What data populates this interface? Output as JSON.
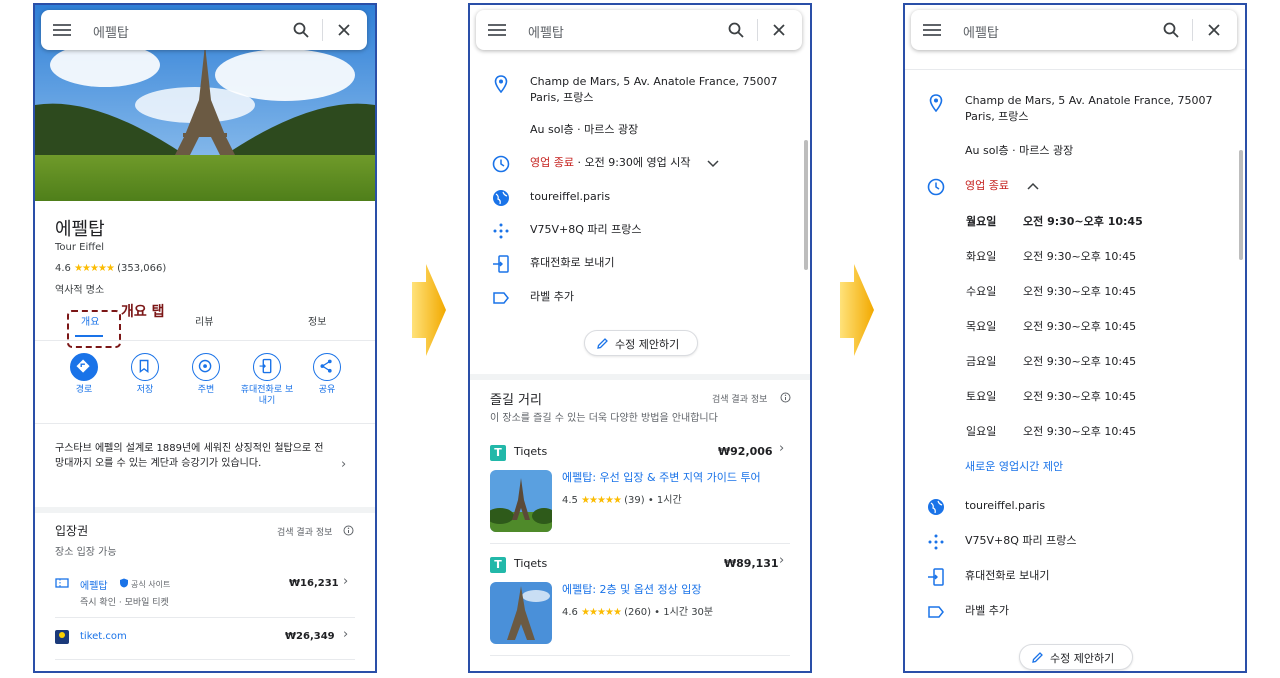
{
  "search": {
    "query": "에펠탑"
  },
  "panel1": {
    "title": "에펠탑",
    "subtitle": "Tour Eiffel",
    "rating": "4.6",
    "stars": "★★★★★",
    "reviews": "(353,066)",
    "category": "역사적 명소",
    "tabs": [
      "개요",
      "리뷰",
      "정보"
    ],
    "annotation": "개요 탭",
    "actions": [
      "경로",
      "저장",
      "주변",
      "휴대전화로 보내기",
      "공유"
    ],
    "description": "구스타브 에펠의 설계로 1889년에 세워진 상징적인 철탑으로 전망대까지 오를 수 있는 계단과 승강기가 있습니다.",
    "tickets_title": "입장권",
    "tickets_info": "검색 결과 정보",
    "tickets_sub": "장소 입장 가능",
    "ticket1": {
      "name": "에펠탑",
      "badge": "공식 사이트",
      "sub": "즉시 확인 · 모바일 티켓",
      "price": "₩16,231"
    },
    "ticket2": {
      "name": "tiket.com",
      "price": "₩26,349"
    }
  },
  "panel2": {
    "address": "Champ de Mars, 5 Av. Anatole France, 75007 Paris, 프랑스",
    "floor": "Au sol층 · 마르스 광장",
    "status_closed": "영업 종료",
    "status_rest": " · 오전 9:30에 영업 시작",
    "website": "toureiffel.paris",
    "pluscode": "V75V+8Q 파리 프랑스",
    "send_phone": "휴대전화로 보내기",
    "add_label": "라벨 추가",
    "suggest_edit": "수정 제안하기",
    "things_title": "즐길 거리",
    "things_info": "검색 결과 정보",
    "things_sub": "이 장소를 즐길 수 있는 더욱 다양한 방법을 안내합니다",
    "offers": [
      {
        "vendor": "Tiqets",
        "price": "₩92,006",
        "title": "에펠탑: 우선 입장 & 주변 지역 가이드 투어",
        "rating": "4.5",
        "stars": "★★★★★",
        "meta": "(39) • 1시간"
      },
      {
        "vendor": "Tiqets",
        "price": "₩89,131",
        "title": "에펠탑: 2층 및 옵션 정상 입장",
        "rating": "4.6",
        "stars": "★★★★★",
        "meta": "(260) • 1시간 30분"
      }
    ]
  },
  "panel3": {
    "address": "Champ de Mars, 5 Av. Anatole France, 75007 Paris, 프랑스",
    "floor": "Au sol층 · 마르스 광장",
    "status_closed": "영업 종료",
    "hours": [
      {
        "day": "월요일",
        "time": "오전 9:30~오후 10:45"
      },
      {
        "day": "화요일",
        "time": "오전 9:30~오후 10:45"
      },
      {
        "day": "수요일",
        "time": "오전 9:30~오후 10:45"
      },
      {
        "day": "목요일",
        "time": "오전 9:30~오후 10:45"
      },
      {
        "day": "금요일",
        "time": "오전 9:30~오후 10:45"
      },
      {
        "day": "토요일",
        "time": "오전 9:30~오후 10:45"
      },
      {
        "day": "일요일",
        "time": "오전 9:30~오후 10:45"
      }
    ],
    "new_hours": "새로운 영업시간 제안",
    "website": "toureiffel.paris",
    "pluscode": "V75V+8Q 파리 프랑스",
    "send_phone": "휴대전화로 보내기",
    "add_label": "라벨 추가",
    "suggest_edit": "수정 제안하기"
  },
  "colors": {
    "accent": "#1a73e8",
    "closed": "#c5221f",
    "annotation": "#7b1616",
    "arrow": "#f5b800",
    "border": "#2a4fa8"
  }
}
